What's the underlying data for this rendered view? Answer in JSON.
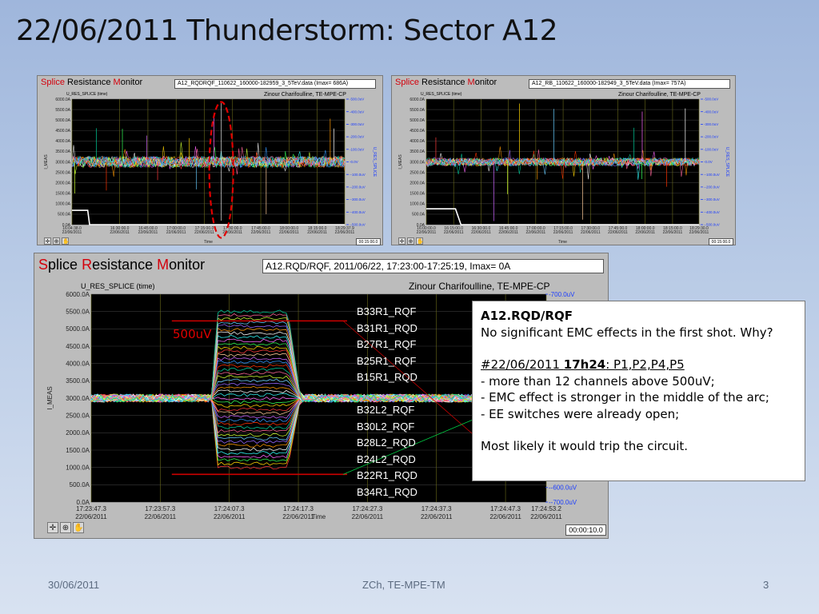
{
  "slide": {
    "title": "22/06/2011 Thunderstorm: Sector A12",
    "footer_date": "30/06/2011",
    "footer_center": "ZCh, TE-MPE-TM",
    "page_number": "3"
  },
  "app_header": {
    "word1_initial": "S",
    "word1_rest": "plice",
    "word2_initial": "R",
    "word2_rest": "esistance",
    "word3_initial": "M",
    "word3_rest": "onitor",
    "author": "Zinour Charifoulline, TE-MPE-CP",
    "y_label": "U_RES_SPLICE (time)",
    "left_axis_name": "I_MEAS",
    "right_axis_name": "U_RES_SPLICE",
    "x_axis_name": "Time"
  },
  "colors": {
    "accent_red": "#d4000b",
    "ring": "#e00000",
    "pos_axis": "#1a3cff"
  },
  "panels": [
    {
      "id": "top-left",
      "file": "A12_RQDRQF_110622_160000-182959_3_5TeV.data (Imax= 686A)",
      "time_window": "00:15:00.0",
      "left_ticks": [
        "6000.0A",
        "5500.0A",
        "5000.0A",
        "4500.0A",
        "4000.0A",
        "3500.0A",
        "3000.0A",
        "2500.0A",
        "2000.0A",
        "1500.0A",
        "1000.0A",
        "500.0A",
        "0.0A"
      ],
      "right_ticks": [
        "500.0uV",
        "400.0uV",
        "300.0uV",
        "200.0uV",
        "100.0uV",
        "0.0V",
        "-100.0uV",
        "-200.0uV",
        "-300.0uV",
        "-400.0uV",
        "-500.0uV"
      ],
      "x_ticks": [
        {
          "t": "16:04:38.0",
          "d": "22/06/2011"
        },
        {
          "t": "16:30:00.0",
          "d": "22/06/2011"
        },
        {
          "t": "16:45:00.0",
          "d": "22/06/2011"
        },
        {
          "t": "17:00:00.0",
          "d": "22/06/2011"
        },
        {
          "t": "17:15:00.0",
          "d": "22/06/2011"
        },
        {
          "t": "17:30:00.0",
          "d": "22/06/2011"
        },
        {
          "t": "17:45:00.0",
          "d": "22/06/2011"
        },
        {
          "t": "18:00:00.0",
          "d": "22/06/2011"
        },
        {
          "t": "18:15:00.0",
          "d": "22/06/2011"
        },
        {
          "t": "18:29:37.9",
          "d": "22/06/2011"
        }
      ]
    },
    {
      "id": "top-right",
      "file": "A12_RB_110622_160000-182949_3_5TeV.data (Imax= 757A)",
      "time_window": "00:15:00.0",
      "left_ticks": [
        "6000.0A",
        "5500.0A",
        "5000.0A",
        "4500.0A",
        "4000.0A",
        "3500.0A",
        "3000.0A",
        "2500.0A",
        "2000.0A",
        "1500.0A",
        "1000.0A",
        "500.0A",
        "0.0A"
      ],
      "right_ticks": [
        "500.0uV",
        "400.0uV",
        "300.0uV",
        "200.0uV",
        "100.0uV",
        "0.0V",
        "-100.0uV",
        "-200.0uV",
        "-300.0uV",
        "-400.0uV",
        "-500.0uV"
      ],
      "x_ticks": [
        {
          "t": "16:00:00.0",
          "d": "22/06/2011"
        },
        {
          "t": "16:15:00.0",
          "d": "22/06/2011"
        },
        {
          "t": "16:30:00.0",
          "d": "22/06/2011"
        },
        {
          "t": "16:45:00.0",
          "d": "22/06/2011"
        },
        {
          "t": "17:00:00.0",
          "d": "22/06/2011"
        },
        {
          "t": "17:15:00.0",
          "d": "22/06/2011"
        },
        {
          "t": "17:30:00.0",
          "d": "22/06/2011"
        },
        {
          "t": "17:45:00.0",
          "d": "22/06/2011"
        },
        {
          "t": "18:00:00.0",
          "d": "22/06/2011"
        },
        {
          "t": "18:15:00.0",
          "d": "22/06/2011"
        },
        {
          "t": "18:29:30.0",
          "d": "22/06/2011"
        }
      ]
    },
    {
      "id": "main",
      "file": "A12.RQD/RQF, 2011/06/22, 17:23:00-17:25:19, Imax= 0A",
      "time_window": "00:00:10.0",
      "left_ticks": [
        "6000.0A",
        "5500.0A",
        "5000.0A",
        "4500.0A",
        "4000.0A",
        "3500.0A",
        "3000.0A",
        "2500.0A",
        "2000.0A",
        "1500.0A",
        "1000.0A",
        "500.0A",
        "0.0A"
      ],
      "right_ticks": [
        "700.0uV",
        "600.0uV",
        "-600.0uV",
        "-700.0uV"
      ],
      "x_ticks": [
        {
          "t": "17:23:47.3",
          "d": "22/06/2011"
        },
        {
          "t": "17:23:57.3",
          "d": "22/06/2011"
        },
        {
          "t": "17:24:07.3",
          "d": "22/06/2011"
        },
        {
          "t": "17:24:17.3",
          "d": "22/06/2011"
        },
        {
          "t": "17:24:27.3",
          "d": "22/06/2011"
        },
        {
          "t": "17:24:37.3",
          "d": "22/06/2011"
        },
        {
          "t": "17:24:47.3",
          "d": "22/06/2011"
        },
        {
          "t": "17:24:53.2",
          "d": "22/06/2011"
        }
      ]
    }
  ],
  "annotation": {
    "threshold_label": "500uV",
    "channels_above": [
      "B33R1_RQF",
      "B31R1_RQD",
      "B27R1_RQF",
      "B25R1_RQF",
      "B15R1_RQD"
    ],
    "channels_below": [
      "B32L2_RQF",
      "B30L2_RQF",
      "B28L2_RQD",
      "B24L2_RQD",
      "B22R1_RQD",
      "B34R1_RQD"
    ]
  },
  "note": {
    "title": "A12.RQD/RQF",
    "line1": "No significant EMC effects in the first shot. Why?",
    "event_date": "#22/06/2011 ",
    "event_time": "17h24",
    "event_rest": ": P1,P2,P4,P5",
    "bullet1": "- more than 12 channels above 500uV;",
    "bullet2": "- EMC effect is stronger in the middle of the arc;",
    "bullet3": "- EE switches were already open;",
    "conclusion": "Most likely it would trip the circuit."
  },
  "chart_data": [
    {
      "type": "line",
      "title": "A12_RQDRQF_110622_160000-182959_3_5TeV.data (Imax= 686A)",
      "ylabel": "I_MEAS",
      "y2label": "U_RES_SPLICE",
      "xlabel": "Time",
      "ylim": [
        0,
        6000
      ],
      "y2lim": [
        "-500.0uV",
        "500.0uV"
      ],
      "series": [
        {
          "name": "I_MEAS",
          "x": [
            "16:04:38.0",
            "16:10:00.0",
            "16:13:00.0",
            "16:14:00.0",
            "18:29:37.9"
          ],
          "values": [
            686,
            686,
            686,
            0,
            0
          ]
        }
      ]
    },
    {
      "type": "line",
      "title": "A12_RB_110622_160000-182949_3_5TeV.data (Imax= 757A)",
      "ylabel": "I_MEAS",
      "y2label": "U_RES_SPLICE",
      "xlabel": "Time",
      "ylim": [
        0,
        6000
      ],
      "y2lim": [
        "-500.0uV",
        "500.0uV"
      ],
      "series": [
        {
          "name": "I_MEAS",
          "x": [
            "16:00:00.0",
            "16:10:00.0",
            "16:16:00.0",
            "16:19:00.0",
            "18:29:30.0"
          ],
          "values": [
            757,
            757,
            757,
            0,
            0
          ]
        }
      ]
    },
    {
      "type": "line",
      "title": "A12.RQD/RQF, 2011/06/22, 17:23:00-17:25:19, Imax= 0A",
      "ylabel": "I_MEAS",
      "y2label": "U_RES_SPLICE",
      "xlabel": "Time",
      "ylim": [
        0,
        6000
      ],
      "y2lim": [
        "-700.0uV",
        "700.0uV"
      ],
      "event_window": [
        "17:24:05.0",
        "17:24:16.0"
      ],
      "threshold": "500uV"
    }
  ]
}
